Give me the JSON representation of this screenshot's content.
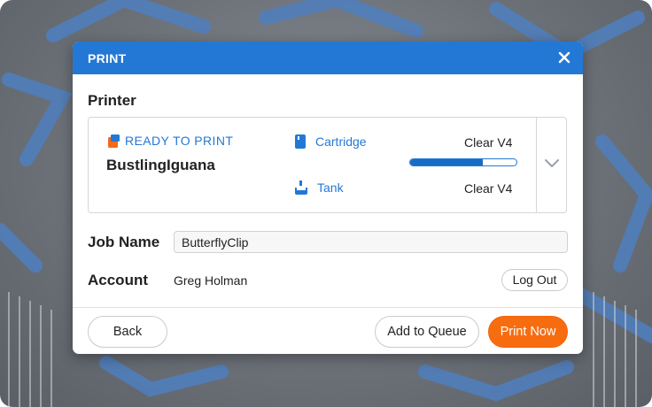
{
  "dialog": {
    "title": "PRINT",
    "printer_section_label": "Printer",
    "printer": {
      "status": "READY TO PRINT",
      "name": "BustlingIguana",
      "cartridge_label": "Cartridge",
      "cartridge_value": "Clear V4",
      "cartridge_level": 0.68,
      "tank_label": "Tank",
      "tank_value": "Clear V4"
    },
    "job_name_label": "Job Name",
    "job_name_value": "ButterflyClip",
    "account_label": "Account",
    "account_name": "Greg Holman",
    "logout_label": "Log Out",
    "back_label": "Back",
    "queue_label": "Add to Queue",
    "print_label": "Print Now"
  },
  "icons": [
    "close-icon",
    "printer-status-icon",
    "cartridge-icon",
    "tank-icon",
    "chevron-down-icon"
  ],
  "colors": {
    "accent": "#2478d5",
    "print_button": "#f86c10",
    "status_orange": "#f26a1b"
  }
}
